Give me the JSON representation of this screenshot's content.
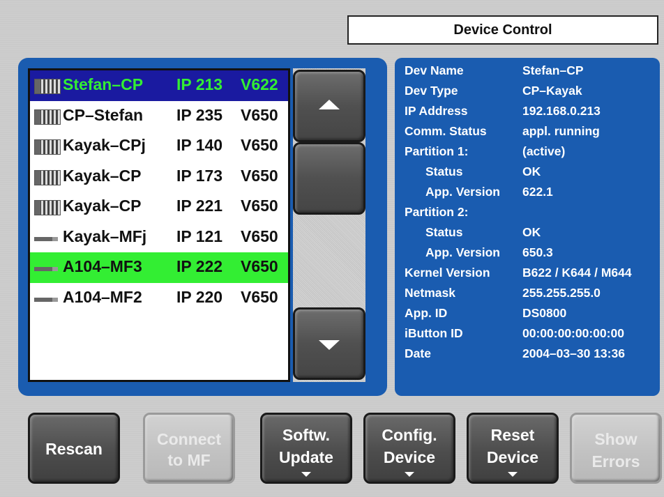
{
  "header": {
    "title": "Device Control"
  },
  "devices": [
    {
      "icon": "cp-panel-icon",
      "name": "Stefan–CP",
      "ip": "IP 213",
      "version": "V622",
      "state": "selected"
    },
    {
      "icon": "cp-panel-icon",
      "name": "CP–Stefan",
      "ip": "IP 235",
      "version": "V650",
      "state": "normal"
    },
    {
      "icon": "cp-panel-icon",
      "name": "Kayak–CPj",
      "ip": "IP 140",
      "version": "V650",
      "state": "normal"
    },
    {
      "icon": "cp-panel-icon",
      "name": "Kayak–CP",
      "ip": "IP 173",
      "version": "V650",
      "state": "normal"
    },
    {
      "icon": "cp-panel-icon",
      "name": "Kayak–CP",
      "ip": "IP 221",
      "version": "V650",
      "state": "normal"
    },
    {
      "icon": "mainframe-icon",
      "name": "Kayak–MFj",
      "ip": "IP 121",
      "version": "V650",
      "state": "normal"
    },
    {
      "icon": "mainframe-icon",
      "name": "A104–MF3",
      "ip": "IP 222",
      "version": "V650",
      "state": "highlight"
    },
    {
      "icon": "mainframe-icon",
      "name": "A104–MF2",
      "ip": "IP 220",
      "version": "V650",
      "state": "normal"
    }
  ],
  "scroll": {
    "up_icon": "arrow-up-icon",
    "down_icon": "arrow-down-icon"
  },
  "details": [
    {
      "label": "Dev Name",
      "value": "Stefan–CP",
      "indent": false
    },
    {
      "label": "Dev Type",
      "value": "CP–Kayak",
      "indent": false
    },
    {
      "label": "IP Address",
      "value": "192.168.0.213",
      "indent": false
    },
    {
      "label": "Comm. Status",
      "value": "appl. running",
      "indent": false
    },
    {
      "label": "Partition 1:",
      "value": "(active)",
      "indent": false
    },
    {
      "label": "Status",
      "value": "OK",
      "indent": true
    },
    {
      "label": "App. Version",
      "value": "622.1",
      "indent": true
    },
    {
      "label": "Partition 2:",
      "value": "",
      "indent": false
    },
    {
      "label": "Status",
      "value": "OK",
      "indent": true
    },
    {
      "label": "App. Version",
      "value": "650.3",
      "indent": true
    },
    {
      "label": "Kernel Version",
      "value": "B622 / K644 / M644",
      "indent": false
    },
    {
      "label": "Netmask",
      "value": "255.255.255.0",
      "indent": false
    },
    {
      "label": "App. ID",
      "value": "DS0800",
      "indent": false
    },
    {
      "label": "iButton ID",
      "value": "00:00:00:00:00:00",
      "indent": false
    },
    {
      "label": "Date",
      "value": "2004–03–30  13:36",
      "indent": false
    }
  ],
  "buttons": {
    "rescan": {
      "line1": "Rescan",
      "line2": ""
    },
    "connect": {
      "line1": "Connect",
      "line2": "to MF"
    },
    "software_update": {
      "line1": "Softw.",
      "line2": "Update"
    },
    "config_device": {
      "line1": "Config.",
      "line2": "Device"
    },
    "reset_device": {
      "line1": "Reset",
      "line2": "Device"
    },
    "show_errors": {
      "line1": "Show",
      "line2": "Errors"
    }
  },
  "colors": {
    "panel_blue": "#1a5cb0",
    "selected_bg": "#1a1aa0",
    "selected_text": "#33ee33",
    "highlight_bg": "#33ee33"
  }
}
